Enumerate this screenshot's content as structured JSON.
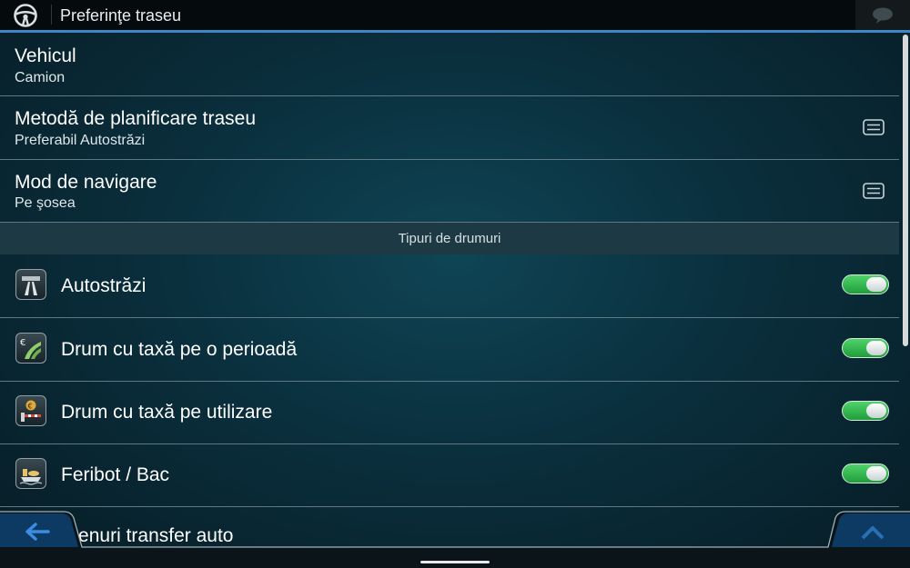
{
  "header": {
    "title": "Preferinţe traseu",
    "logo_icon": "steering-wheel-icon",
    "message_icon": "speech-bubble-icon"
  },
  "settings": [
    {
      "label": "Vehicul",
      "value": "Camion"
    },
    {
      "label": "Metodă de planificare traseu",
      "value": "Preferabil Autostrăzi",
      "action_icon": "list-icon"
    },
    {
      "label": "Mod de navigare",
      "value": "Pe şosea",
      "action_icon": "list-icon"
    }
  ],
  "section_header": "Tipuri de drumuri",
  "road_types": [
    {
      "label": "Autostrăzi",
      "icon": "highway-icon",
      "enabled": true
    },
    {
      "label": "Drum cu taxă pe o perioadă",
      "icon": "toll-period-icon",
      "enabled": true
    },
    {
      "label": "Drum cu taxă pe utilizare",
      "icon": "toll-use-icon",
      "enabled": true
    },
    {
      "label": "Feribot / Bac",
      "icon": "ferry-icon",
      "enabled": true
    },
    {
      "label": "Trenuri transfer auto",
      "icon": "car-train-icon"
    }
  ],
  "footer": {
    "back_icon": "back-arrow-icon",
    "up_icon": "chevron-up-icon"
  },
  "colors": {
    "accent": "#3f86c6",
    "toggle_on": "#2fbf4a"
  }
}
